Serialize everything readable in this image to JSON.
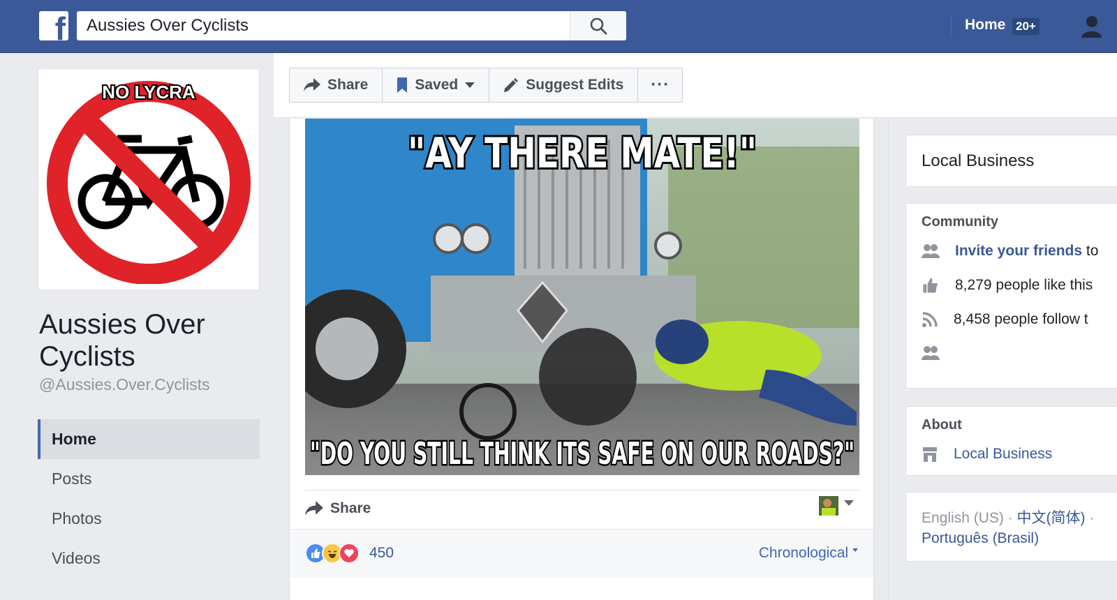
{
  "topbar": {
    "search_value": "Aussies Over Cyclists",
    "home_label": "Home",
    "home_badge": "20+"
  },
  "profile": {
    "picture_text": "NO LYCRA",
    "name": "Aussies Over Cyclists",
    "handle": "@Aussies.Over.Cyclists"
  },
  "sidebar": {
    "items": [
      {
        "label": "Home",
        "active": true
      },
      {
        "label": "Posts"
      },
      {
        "label": "Photos"
      },
      {
        "label": "Videos"
      }
    ]
  },
  "actions": {
    "share_label": "Share",
    "saved_label": "Saved",
    "suggest_label": "Suggest Edits",
    "more_label": "···"
  },
  "post": {
    "meme_top": "\"AY THERE MATE!\"",
    "meme_bottom": "\"DO YOU STILL THINK ITS SAFE ON OUR ROADS?\"",
    "share_label": "Share",
    "reaction_count": "450",
    "sort_label": "Chronological"
  },
  "right": {
    "category": "Local Business",
    "community_title": "Community",
    "invite_link": "Invite your friends",
    "invite_suffix": "to",
    "likes_text": "8,279 people like this",
    "follows_text": "8,458 people follow t",
    "about_title": "About",
    "about_category": "Local Business",
    "lang_current": "English (US)",
    "lang_sep1": " · ",
    "lang_chinese": "中文(简体)",
    "lang_sep2": " · ",
    "lang_portuguese": "Português (Brasil)"
  },
  "colors": {
    "brand": "#3b5998",
    "link": "#385898",
    "sidebar_active_border": "#4267b2"
  }
}
